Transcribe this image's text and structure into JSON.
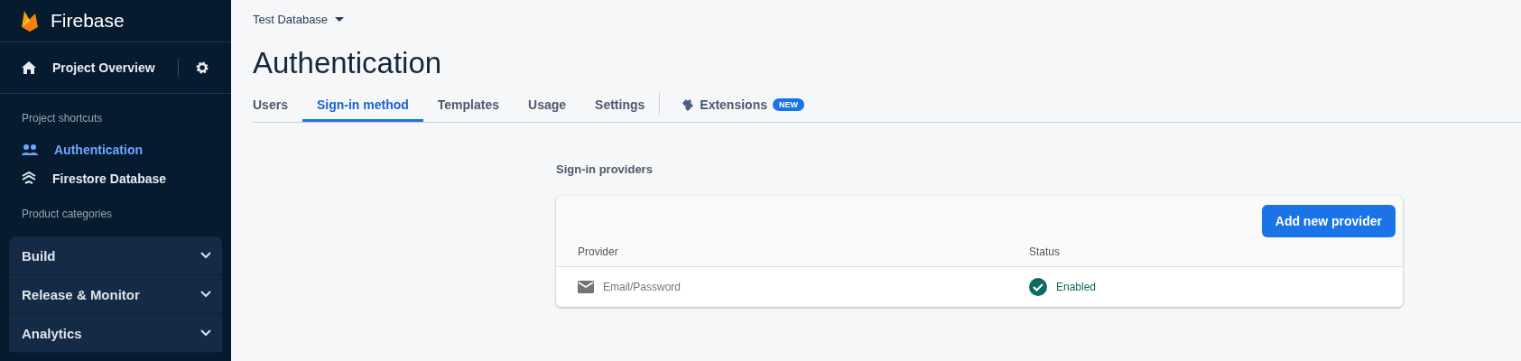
{
  "sidebar": {
    "brand": "Firebase",
    "overview": "Project Overview",
    "shortcuts_heading": "Project shortcuts",
    "shortcuts": [
      {
        "label": "Authentication",
        "kind": "people",
        "selected": true
      },
      {
        "label": "Firestore Database",
        "kind": "firestore",
        "selected": false
      }
    ],
    "categories_heading": "Product categories",
    "categories": [
      {
        "label": "Build",
        "expanded": false
      },
      {
        "label": "Release & Monitor",
        "expanded": false
      },
      {
        "label": "Analytics",
        "expanded": false
      }
    ]
  },
  "project_selector": "Test Database",
  "title": "Authentication",
  "tabs": [
    {
      "label": "Users",
      "selected": false
    },
    {
      "label": "Sign-in method",
      "selected": true
    },
    {
      "label": "Templates",
      "selected": false
    },
    {
      "label": "Usage",
      "selected": false
    },
    {
      "label": "Settings",
      "selected": false
    }
  ],
  "extensions_tab": {
    "label": "Extensions",
    "badge": "NEW",
    "selected": false
  },
  "section_title": "Sign-in providers",
  "add_button": "Add new provider",
  "table": {
    "columns": [
      "Provider",
      "Status"
    ],
    "rows": [
      {
        "provider": "Email/Password",
        "status": "Enabled",
        "enabled": true
      }
    ]
  }
}
